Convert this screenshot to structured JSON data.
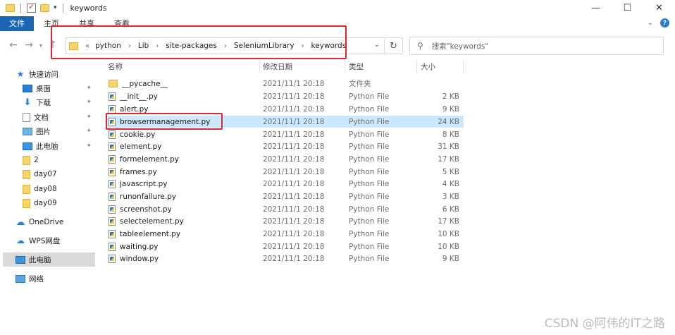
{
  "window": {
    "title": "keywords",
    "controls": [
      "—",
      "☐",
      "✕"
    ]
  },
  "ribbon": {
    "file_tab": "文件",
    "tabs": [
      "主页",
      "共享",
      "查看"
    ]
  },
  "address": {
    "breadcrumbs": [
      "python",
      "Lib",
      "site-packages",
      "SeleniumLibrary",
      "keywords"
    ],
    "search_placeholder": "搜索\"keywords\""
  },
  "sidebar": {
    "items": [
      {
        "label": "快速访问",
        "icon": "star-icon",
        "pinned": false
      },
      {
        "label": "桌面",
        "icon": "desktop-icon",
        "pinned": true
      },
      {
        "label": "下载",
        "icon": "download-icon",
        "pinned": true
      },
      {
        "label": "文档",
        "icon": "document-icon",
        "pinned": true
      },
      {
        "label": "图片",
        "icon": "pictures-icon",
        "pinned": true
      },
      {
        "label": "此电脑",
        "icon": "computer-icon",
        "pinned": true
      },
      {
        "label": "2",
        "icon": "folder-icon",
        "pinned": false
      },
      {
        "label": "day07",
        "icon": "folder-icon",
        "pinned": false
      },
      {
        "label": "day08",
        "icon": "folder-icon",
        "pinned": false
      },
      {
        "label": "day09",
        "icon": "folder-icon",
        "pinned": false
      },
      {
        "label": "OneDrive",
        "icon": "onedrive-icon",
        "pinned": false
      },
      {
        "label": "WPS网盘",
        "icon": "wps-cloud-icon",
        "pinned": false
      },
      {
        "label": "此电脑",
        "icon": "computer-icon",
        "pinned": false,
        "selected": true
      },
      {
        "label": "网络",
        "icon": "network-icon",
        "pinned": false
      }
    ]
  },
  "columns": {
    "name": "名称",
    "date": "修改日期",
    "type": "类型",
    "size": "大小"
  },
  "files": [
    {
      "name": "__pycache__",
      "date": "2021/11/1 20:18",
      "type": "文件夹",
      "size": "",
      "kind": "folder"
    },
    {
      "name": "__init__.py",
      "date": "2021/11/1 20:18",
      "type": "Python File",
      "size": "2 KB",
      "kind": "py"
    },
    {
      "name": "alert.py",
      "date": "2021/11/1 20:18",
      "type": "Python File",
      "size": "9 KB",
      "kind": "py"
    },
    {
      "name": "browsermanagement.py",
      "date": "2021/11/1 20:18",
      "type": "Python File",
      "size": "24 KB",
      "kind": "py",
      "selected": true
    },
    {
      "name": "cookie.py",
      "date": "2021/11/1 20:18",
      "type": "Python File",
      "size": "8 KB",
      "kind": "py"
    },
    {
      "name": "element.py",
      "date": "2021/11/1 20:18",
      "type": "Python File",
      "size": "31 KB",
      "kind": "py"
    },
    {
      "name": "formelement.py",
      "date": "2021/11/1 20:18",
      "type": "Python File",
      "size": "17 KB",
      "kind": "py"
    },
    {
      "name": "frames.py",
      "date": "2021/11/1 20:18",
      "type": "Python File",
      "size": "5 KB",
      "kind": "py"
    },
    {
      "name": "javascript.py",
      "date": "2021/11/1 20:18",
      "type": "Python File",
      "size": "4 KB",
      "kind": "py"
    },
    {
      "name": "runonfailure.py",
      "date": "2021/11/1 20:18",
      "type": "Python File",
      "size": "3 KB",
      "kind": "py"
    },
    {
      "name": "screenshot.py",
      "date": "2021/11/1 20:18",
      "type": "Python File",
      "size": "6 KB",
      "kind": "py"
    },
    {
      "name": "selectelement.py",
      "date": "2021/11/1 20:18",
      "type": "Python File",
      "size": "17 KB",
      "kind": "py"
    },
    {
      "name": "tableelement.py",
      "date": "2021/11/1 20:18",
      "type": "Python File",
      "size": "10 KB",
      "kind": "py"
    },
    {
      "name": "waiting.py",
      "date": "2021/11/1 20:18",
      "type": "Python File",
      "size": "10 KB",
      "kind": "py"
    },
    {
      "name": "window.py",
      "date": "2021/11/1 20:18",
      "type": "Python File",
      "size": "9 KB",
      "kind": "py"
    }
  ],
  "watermark": "CSDN @阿伟的IT之路",
  "colors": {
    "accent": "#1a66b4",
    "selection": "#cce8ff",
    "highlight_box": "#e2262b"
  }
}
